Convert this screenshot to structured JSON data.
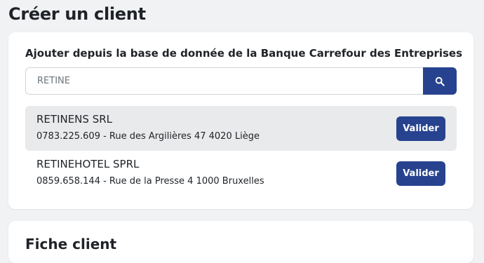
{
  "page": {
    "title": "Créer un client"
  },
  "search_card": {
    "heading": "Ajouter depuis la base de donnée de la Banque Carrefour des Entreprises",
    "search": {
      "value": "RETINE",
      "placeholder": "",
      "button_icon": "search-icon"
    },
    "results": [
      {
        "name": "RETINENS SRL",
        "detail": "0783.225.609 - Rue des Argilières 47 4020 Liège",
        "action": "Valider"
      },
      {
        "name": "RETINEHOTEL SPRL",
        "detail": "0859.658.144 - Rue de la Presse 4 1000 Bruxelles",
        "action": "Valider"
      }
    ]
  },
  "fiche_card": {
    "title": "Fiche client"
  },
  "colors": {
    "accent": "#27438f",
    "background": "#f1f2f4",
    "row_highlight": "#e9eaec"
  }
}
